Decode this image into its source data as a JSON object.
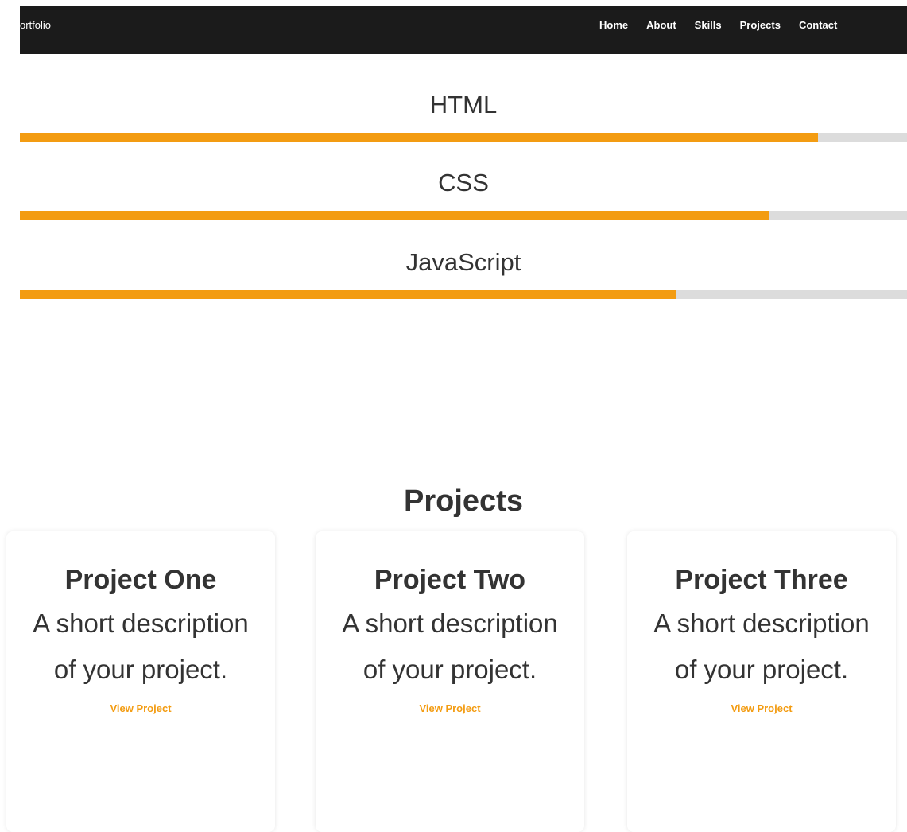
{
  "nav": {
    "brand": "ortfolio",
    "links": [
      "Home",
      "About",
      "Skills",
      "Projects",
      "Contact"
    ]
  },
  "skills": [
    {
      "name": "HTML",
      "level": 0.9
    },
    {
      "name": "CSS",
      "level": 0.845
    },
    {
      "name": "JavaScript",
      "level": 0.74
    }
  ],
  "projects": {
    "title": "Projects",
    "items": [
      {
        "title": "Project One",
        "description": "A short description of your project.",
        "link": "View Project"
      },
      {
        "title": "Project Two",
        "description": "A short description of your project.",
        "link": "View Project"
      },
      {
        "title": "Project Three",
        "description": "A short description of your project.",
        "link": "View Project"
      }
    ]
  },
  "colors": {
    "nav_bg": "#1b1b1b",
    "accent": "#f39c12",
    "track": "#dcdcdc"
  }
}
